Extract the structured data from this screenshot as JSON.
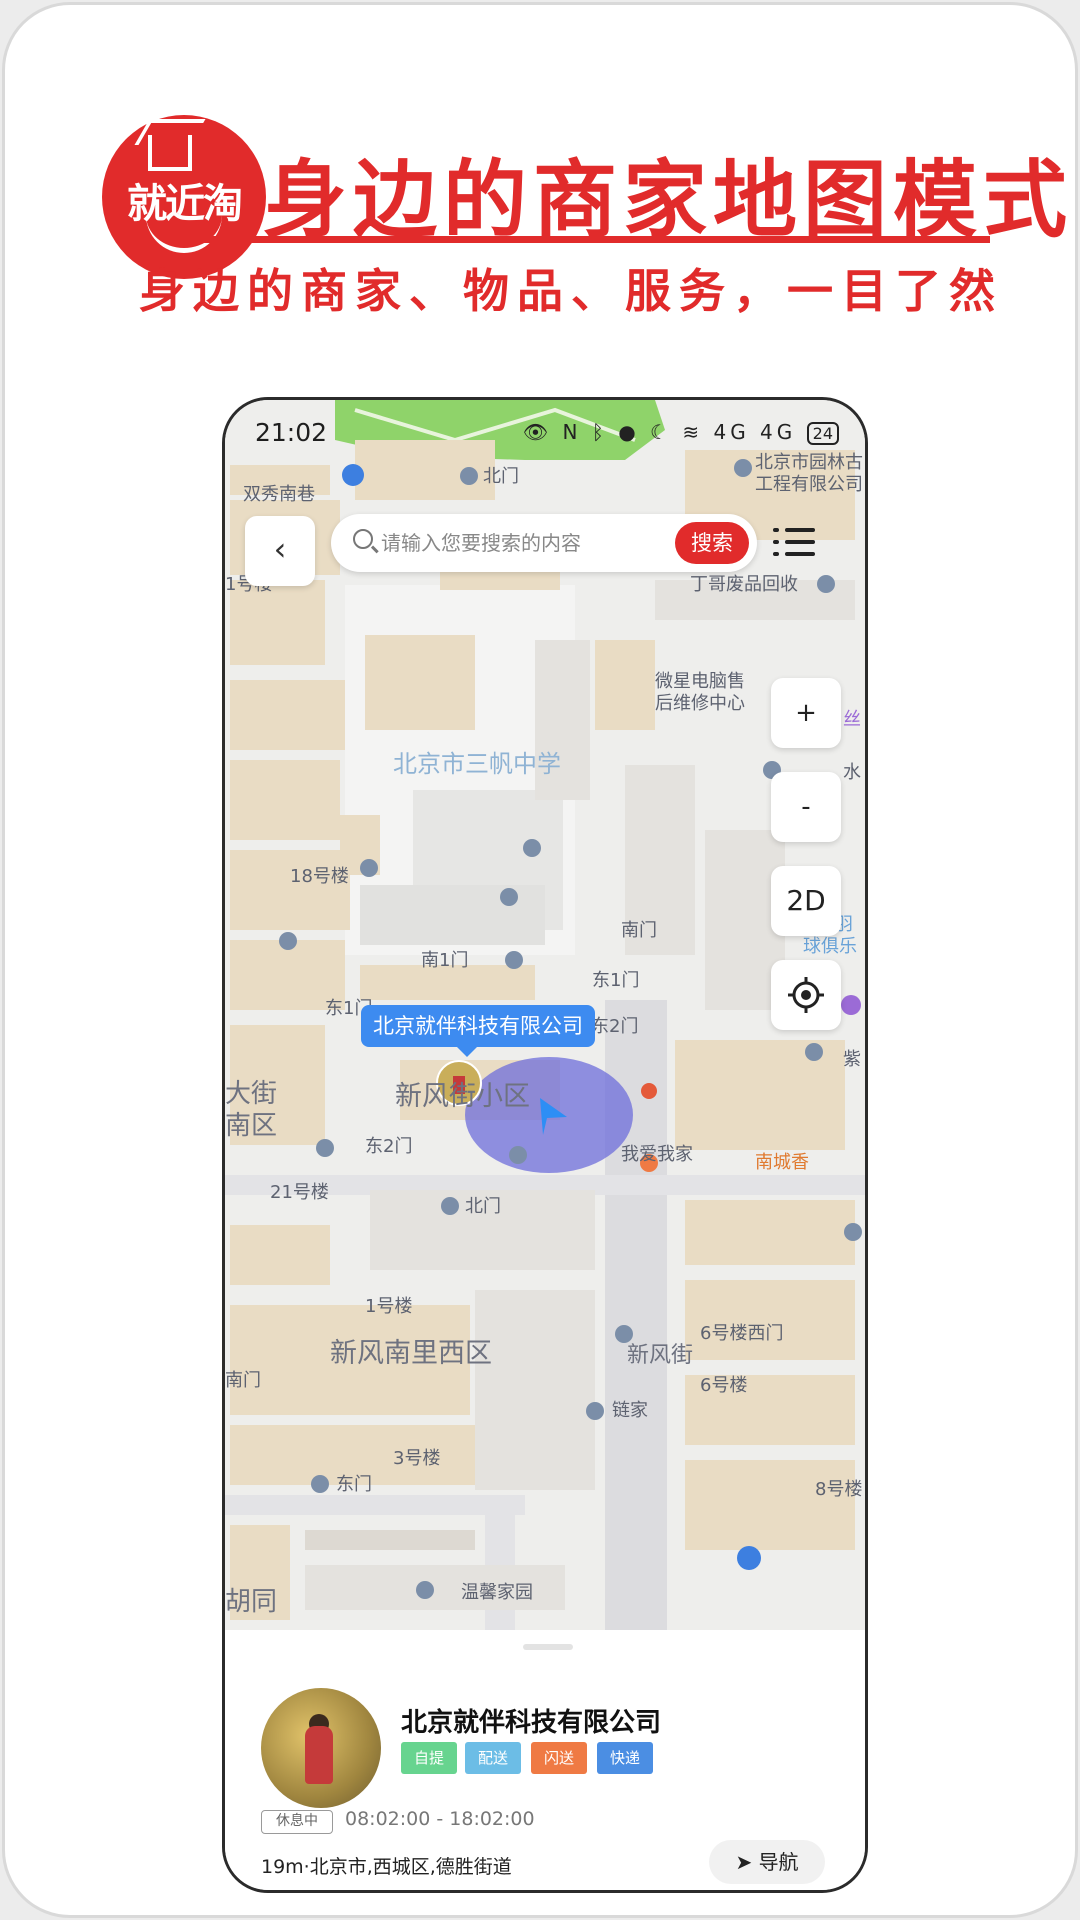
{
  "promo": {
    "logo_text": "就近淘",
    "headline": "身边的商家地图模式",
    "subline": "身边的商家、物品、服务，一目了然"
  },
  "status_bar": {
    "time": "21:02",
    "battery": "24",
    "network": "4G 4G"
  },
  "search": {
    "placeholder": "请输入您要搜索的内容",
    "button": "搜索"
  },
  "map": {
    "zoom_in": "+",
    "zoom_out": "-",
    "view_mode": "2D",
    "callout": "北京就伴科技有限公司",
    "labels": {
      "l1": "双秀南巷",
      "l2": "北门",
      "l3": "北京市园林古",
      "l4": "工程有限公司",
      "l5": "1号楼",
      "l6": "丁哥废品回收",
      "l7": "微星电脑售",
      "l8": "后维修中心",
      "l9": "北京市三帆中学",
      "l10": "18号楼",
      "l11": "南门",
      "l12": "南1门",
      "l13": "东1门",
      "l14": "东1门",
      "l15": "东2门",
      "l16": "新风街小区",
      "l17": "东2门",
      "l18": "我爱我家",
      "l19": "南城香",
      "l20": "21号楼",
      "l21": "北门",
      "l22": "6号楼西门",
      "l23": "1号楼",
      "l24": "新风南里西区",
      "l25": "6号楼",
      "l26": "新风街",
      "l27": "链家",
      "l28": "3号楼",
      "l29": "东门",
      "l30": "8号楼",
      "l31": "温馨家园",
      "l32": "胡同",
      "l33": "紫",
      "l34": "大街",
      "l35": "南区",
      "l36": "南门",
      "l37": "丝",
      "l38": "水",
      "l39": "羽",
      "l40": "球俱乐"
    }
  },
  "shop": {
    "name": "北京就伴科技有限公司",
    "tags": [
      "自提",
      "配送",
      "闪送",
      "快递"
    ],
    "status": "休息中",
    "hours": "08:02:00 - 18:02:00",
    "address": "19m·北京市,西城区,德胜街道",
    "nav_label": "导航"
  },
  "colors": {
    "brand_red": "#e12b2b",
    "tag_pickup": "#67d48f",
    "tag_delivery": "#6cbde6",
    "tag_flash": "#ef7a44",
    "tag_express": "#4b8ee3",
    "callout_blue": "#3d8bf0"
  }
}
